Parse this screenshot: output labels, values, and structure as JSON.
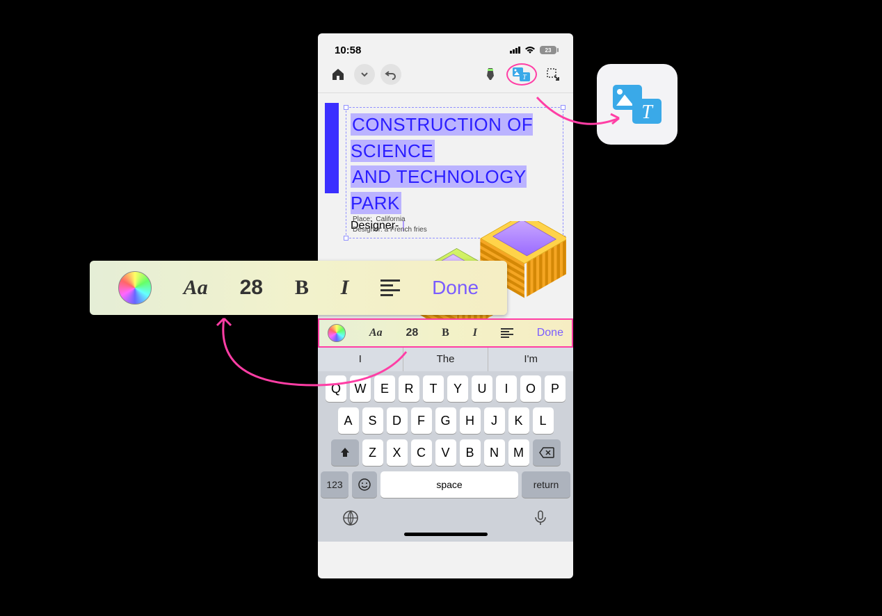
{
  "status": {
    "time": "10:58",
    "battery": "23"
  },
  "toolbar": {
    "home": "home-icon",
    "dropdown": "chevron-down-icon",
    "undo": "undo-icon",
    "pen": "highlighter-icon",
    "media_text": "image-text-icon",
    "lasso": "lasso-icon"
  },
  "document": {
    "title_line1": "CONSTRUCTION OF SCIENCE",
    "title_line2": "AND TECHNOLOGY PARK",
    "subtitle": "Designer- ",
    "meta_place_label": "Place:",
    "meta_place_value": "California",
    "meta_designer_label": "Designer:",
    "meta_designer_value": "a French fries"
  },
  "format_bar": {
    "font_label": "Aa",
    "size": "28",
    "bold": "B",
    "italic": "I",
    "done": "Done"
  },
  "suggestions": {
    "s1": "I",
    "s2": "The",
    "s3": "I'm"
  },
  "keyboard": {
    "row1": [
      "Q",
      "W",
      "E",
      "R",
      "T",
      "Y",
      "U",
      "I",
      "O",
      "P"
    ],
    "row2": [
      "A",
      "S",
      "D",
      "F",
      "G",
      "H",
      "J",
      "K",
      "L"
    ],
    "row3": [
      "Z",
      "X",
      "C",
      "V",
      "B",
      "N",
      "M"
    ],
    "numeric": "123",
    "space": "space",
    "return": "return"
  }
}
